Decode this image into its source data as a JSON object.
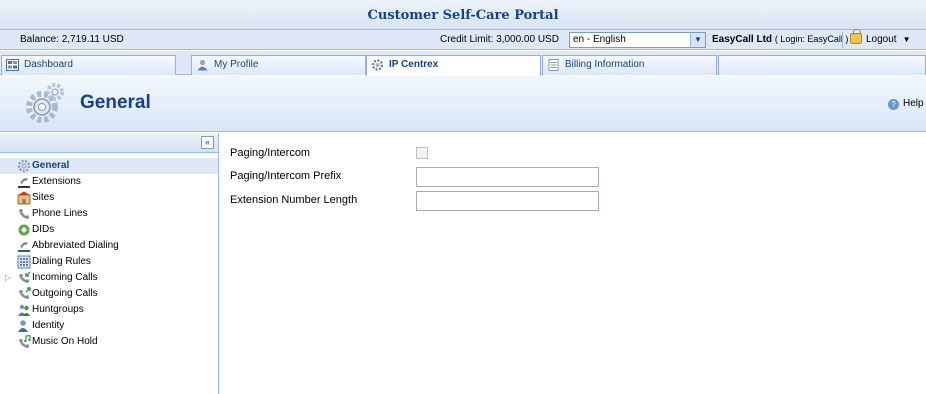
{
  "app": {
    "title": "Customer Self-Care Portal"
  },
  "infobar": {
    "balance": "Balance: 2,719.11 USD",
    "credit_limit": "Credit Limit: 3,000.00 USD",
    "language": "en - English",
    "account_name": "EasyCall Ltd",
    "login": "( Login: EasyCall )",
    "logout": "Logout"
  },
  "tabs": [
    {
      "label": "Dashboard",
      "icon": "dashboard-icon"
    },
    {
      "label": "My Profile",
      "icon": "user-icon"
    },
    {
      "label": "IP Centrex",
      "icon": "gear-icon",
      "active": true
    },
    {
      "label": "Billing Information",
      "icon": "document-icon"
    }
  ],
  "header": {
    "title": "General",
    "help": "Help"
  },
  "sidebar": {
    "items": [
      {
        "label": "General",
        "icon": "gear-icon",
        "selected": true
      },
      {
        "label": "Extensions",
        "icon": "extensions-icon"
      },
      {
        "label": "Sites",
        "icon": "sites-icon"
      },
      {
        "label": "Phone Lines",
        "icon": "phone-lines-icon"
      },
      {
        "label": "DIDs",
        "icon": "dids-icon"
      },
      {
        "label": "Abbreviated Dialing",
        "icon": "abbreviated-dialing-icon"
      },
      {
        "label": "Dialing Rules",
        "icon": "dialing-rules-icon"
      },
      {
        "label": "Incoming Calls",
        "icon": "incoming-calls-icon",
        "expandable": true
      },
      {
        "label": "Outgoing Calls",
        "icon": "outgoing-calls-icon"
      },
      {
        "label": "Huntgroups",
        "icon": "huntgroups-icon"
      },
      {
        "label": "Identity",
        "icon": "identity-icon"
      },
      {
        "label": "Music On Hold",
        "icon": "music-on-hold-icon"
      }
    ]
  },
  "form": {
    "paging_intercom": {
      "label": "Paging/Intercom",
      "checked": false
    },
    "paging_prefix": {
      "label": "Paging/Intercom Prefix",
      "value": ""
    },
    "extension_length": {
      "label": "Extension Number Length",
      "value": ""
    }
  },
  "colors": {
    "accent": "#15428b",
    "border": "#99bbe8",
    "panel": "#dfe8f6"
  }
}
